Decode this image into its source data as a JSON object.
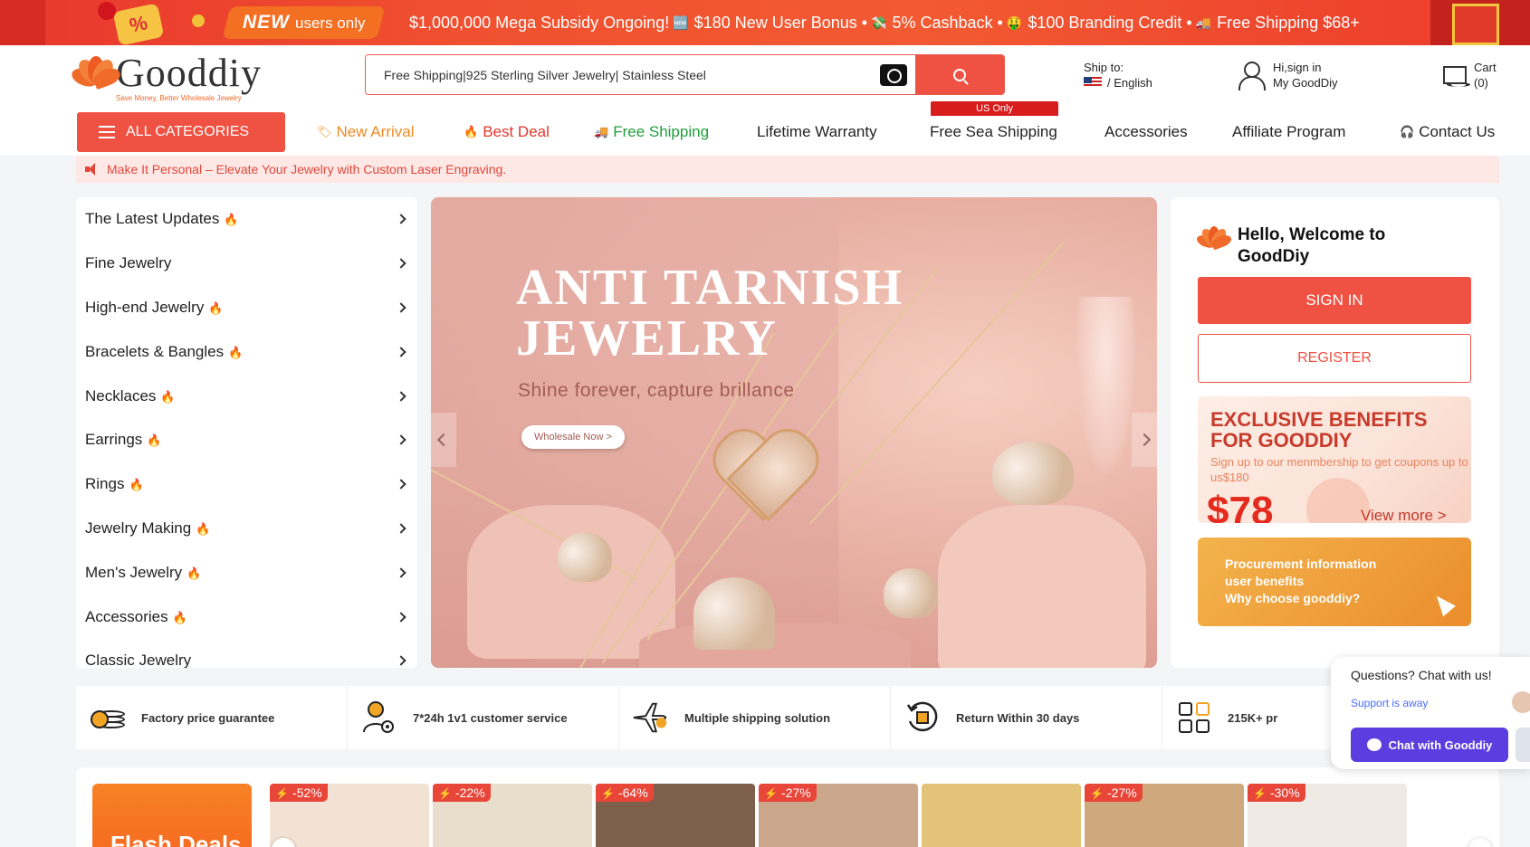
{
  "promo": {
    "new_word": "NEW",
    "users_only": "users only",
    "percent_badge": "%",
    "items": [
      {
        "icon": "🆕",
        "text": "$1,000,000 Mega Subsidy Ongoing!"
      },
      {
        "icon": "",
        "text": "$180 New User Bonus •"
      },
      {
        "icon": "💸",
        "text": "5% Cashback •"
      },
      {
        "icon": "🤑",
        "text": "$100 Branding Credit •"
      },
      {
        "icon": "🚚",
        "text": "Free Shipping $68+"
      }
    ]
  },
  "header": {
    "logo_text": "Gooddiy",
    "logo_tagline": "Save Money, Better Wholesale Jewelry",
    "search_value": "Free Shipping|925 Sterling Silver Jewelry| Stainless Steel",
    "ship_to_label": "Ship to:",
    "language": "/ English",
    "sign_in_greeting": "Hi,sign in",
    "account_label": "My GoodDiy",
    "cart_label": "Cart",
    "cart_count": "(0)"
  },
  "nav": {
    "all_categories": "ALL CATEGORIES",
    "us_only_badge": "US Only",
    "links": [
      {
        "label": "New Arrival",
        "color": "#f08a24",
        "icon": "🏷"
      },
      {
        "label": "Best Deal",
        "color": "#e3372b",
        "icon": "🔥"
      },
      {
        "label": "Free Shipping",
        "color": "#1f9d3a",
        "icon": "🚚"
      },
      {
        "label": "Lifetime Warranty",
        "color": "#222222",
        "icon": ""
      },
      {
        "label": "Free Sea Shipping",
        "color": "#222222",
        "icon": ""
      },
      {
        "label": "Accessories",
        "color": "#222222",
        "icon": ""
      },
      {
        "label": "Affiliate Program",
        "color": "#222222",
        "icon": ""
      },
      {
        "label": "Contact Us",
        "color": "#222222",
        "icon": "🎧"
      }
    ]
  },
  "notice": "Make It Personal – Elevate Your Jewelry with Custom Laser Engraving.",
  "categories": [
    {
      "label": "The Latest Updates",
      "hot": true
    },
    {
      "label": "Fine Jewelry",
      "hot": false
    },
    {
      "label": "High-end Jewelry",
      "hot": true
    },
    {
      "label": "Bracelets & Bangles",
      "hot": true
    },
    {
      "label": "Necklaces",
      "hot": true
    },
    {
      "label": "Earrings",
      "hot": true
    },
    {
      "label": "Rings",
      "hot": true
    },
    {
      "label": "Jewelry Making",
      "hot": true
    },
    {
      "label": "Men's Jewelry",
      "hot": true
    },
    {
      "label": "Accessories",
      "hot": true
    },
    {
      "label": "Classic Jewelry",
      "hot": false
    }
  ],
  "banner": {
    "title_line1": "ANTI TARNISH",
    "title_line2": "JEWELRY",
    "subtitle": "Shine forever, capture brillance",
    "cta": "Wholesale Now >"
  },
  "welcome": {
    "title": "Hello, Welcome to GoodDiy",
    "sign_in": "SIGN IN",
    "register": "REGISTER",
    "benefit_title_1": "EXCLUSIVE BENEFITS",
    "benefit_title_2": "FOR GOODDIY",
    "benefit_desc": "Sign up to our menmbership to get coupons up to us$180",
    "benefit_amount": "$78",
    "view_more": "View more >",
    "procurement_1": "Procurement information",
    "procurement_2": "user benefits",
    "procurement_3": "Why choose gooddiy?"
  },
  "features": [
    {
      "label": "Factory price guarantee",
      "icon": "coins-icon"
    },
    {
      "label": "7*24h 1v1 customer service",
      "icon": "support-agent-icon"
    },
    {
      "label": "Multiple shipping solution",
      "icon": "airplane-icon"
    },
    {
      "label": "Return Within 30 days",
      "icon": "return-icon"
    },
    {
      "label": "215K+ pr",
      "icon": "grid-icon"
    }
  ],
  "chat": {
    "question": "Questions? Chat with us!",
    "status": "Support is away",
    "button": "Chat with Gooddiy"
  },
  "flash": {
    "title": "Flash Deals",
    "products": [
      {
        "discount": "-52%",
        "bg": "#f2e2d4"
      },
      {
        "discount": "-22%",
        "bg": "#e9ddcc"
      },
      {
        "discount": "-64%",
        "bg": "#7d5f4b"
      },
      {
        "discount": "-27%",
        "bg": "#caa68a"
      },
      {
        "discount": "",
        "bg": "#e3c27a"
      },
      {
        "discount": "-27%",
        "bg": "#cfa97d"
      },
      {
        "discount": "-30%",
        "bg": "#efeae4"
      }
    ]
  }
}
